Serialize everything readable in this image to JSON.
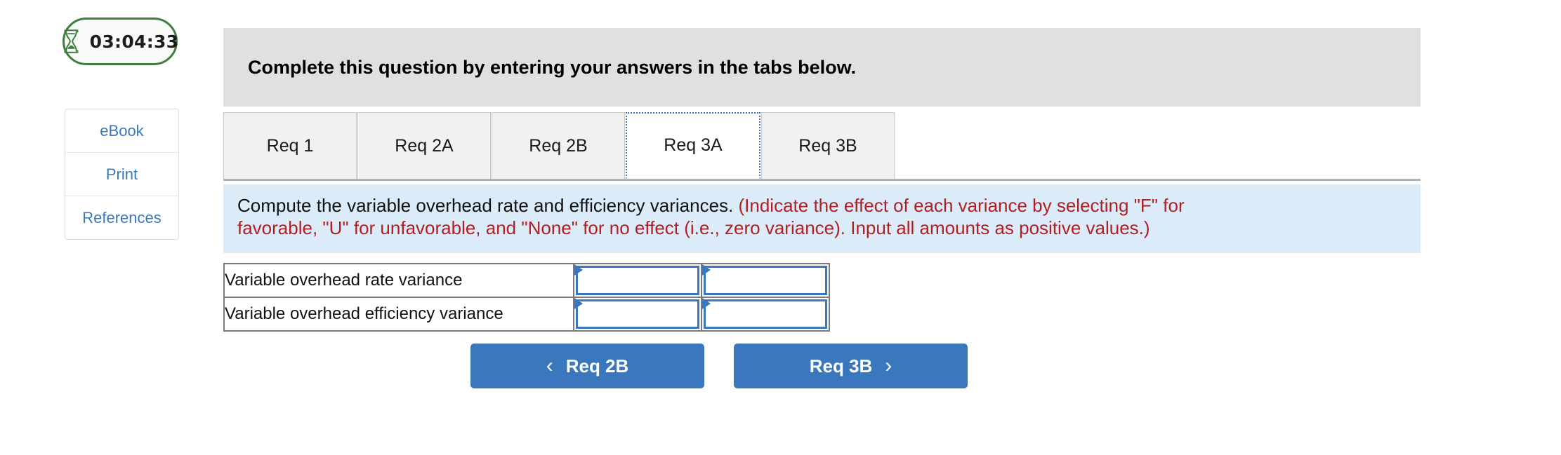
{
  "timer": {
    "icon": "hourglass-icon",
    "value": "03:04:33",
    "border_color": "#417d41"
  },
  "sidebar": {
    "items": [
      {
        "label": "eBook",
        "name": "ebook"
      },
      {
        "label": "Print",
        "name": "print"
      },
      {
        "label": "References",
        "name": "references"
      }
    ],
    "link_color": "#3b77bc"
  },
  "header": {
    "title": "Complete this question by entering your answers in the tabs below.",
    "background": "#e0e0e0"
  },
  "tabs": {
    "active_index": 3,
    "items": [
      {
        "label": "Req 1"
      },
      {
        "label": "Req 2A"
      },
      {
        "label": "Req 2B"
      },
      {
        "label": "Req 3A"
      },
      {
        "label": "Req 3B"
      }
    ]
  },
  "instructions": {
    "line1_black": "Compute the variable overhead rate and efficiency variances. ",
    "line1_red": "(Indicate the effect of each variance by selecting \"F\" for",
    "line2_red": "favorable, \"U\" for unfavorable, and \"None\" for no effect (i.e., zero variance). Input all amounts as positive values.)",
    "background": "#dcebf8",
    "red_color": "#b01f24"
  },
  "answer_table": {
    "rows": [
      {
        "label": "Variable overhead rate variance",
        "amount": "",
        "effect": ""
      },
      {
        "label": "Variable overhead efficiency variance",
        "amount": "",
        "effect": ""
      }
    ],
    "input_border_color": "#3b77bc"
  },
  "navigation": {
    "prev": {
      "label": "Req 2B",
      "icon": "chevron-left-icon"
    },
    "next": {
      "label": "Req 3B",
      "icon": "chevron-right-icon"
    },
    "button_color": "#3b77bc"
  }
}
